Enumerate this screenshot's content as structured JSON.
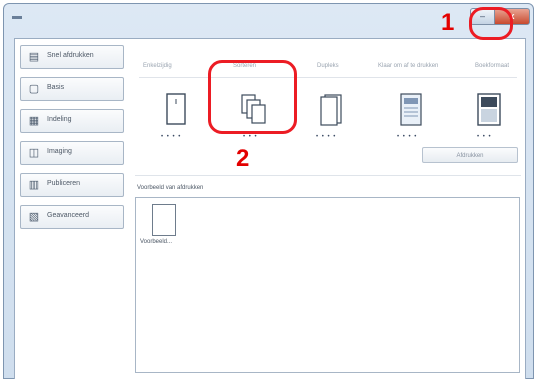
{
  "window": {
    "minimize_glyph": "–",
    "close_glyph": "x"
  },
  "nav": {
    "items": [
      {
        "label": "Snel afdrukken",
        "icon": "quick-print-icon",
        "glyph": "▤"
      },
      {
        "label": "Basis",
        "icon": "basic-icon",
        "glyph": "▢"
      },
      {
        "label": "Indeling",
        "icon": "layout-icon",
        "glyph": "▦"
      },
      {
        "label": "Imaging",
        "icon": "imaging-icon",
        "glyph": "◫"
      },
      {
        "label": "Publiceren",
        "icon": "publishing-icon",
        "glyph": "▥"
      },
      {
        "label": "Geavanceerd",
        "icon": "advanced-icon",
        "glyph": "▧"
      }
    ]
  },
  "layouts": [
    {
      "label": "Enkelzijdig",
      "dots": "• • • •",
      "icon": "single-sided-icon"
    },
    {
      "label": "Sorteren",
      "dots": "• • •",
      "icon": "collate-icon"
    },
    {
      "label": "Dupleks",
      "dots": "• • • •",
      "icon": "duplex-icon"
    },
    {
      "label": "Klaar om af te drukken",
      "dots": "• • • •",
      "icon": "print-ready-icon"
    },
    {
      "label": "Boekformaat",
      "dots": "• • •",
      "icon": "booklet-icon"
    }
  ],
  "pages_button": "Afdrukken",
  "preview": {
    "title": "Voorbeeld van afdrukken",
    "thumb_label": "Voorbeeld..."
  },
  "callouts": {
    "one": "1",
    "two": "2"
  },
  "colors": {
    "callout_red": "#ec1c24",
    "close_red": "#c84a2f",
    "window_blue": "#cfdeee"
  }
}
